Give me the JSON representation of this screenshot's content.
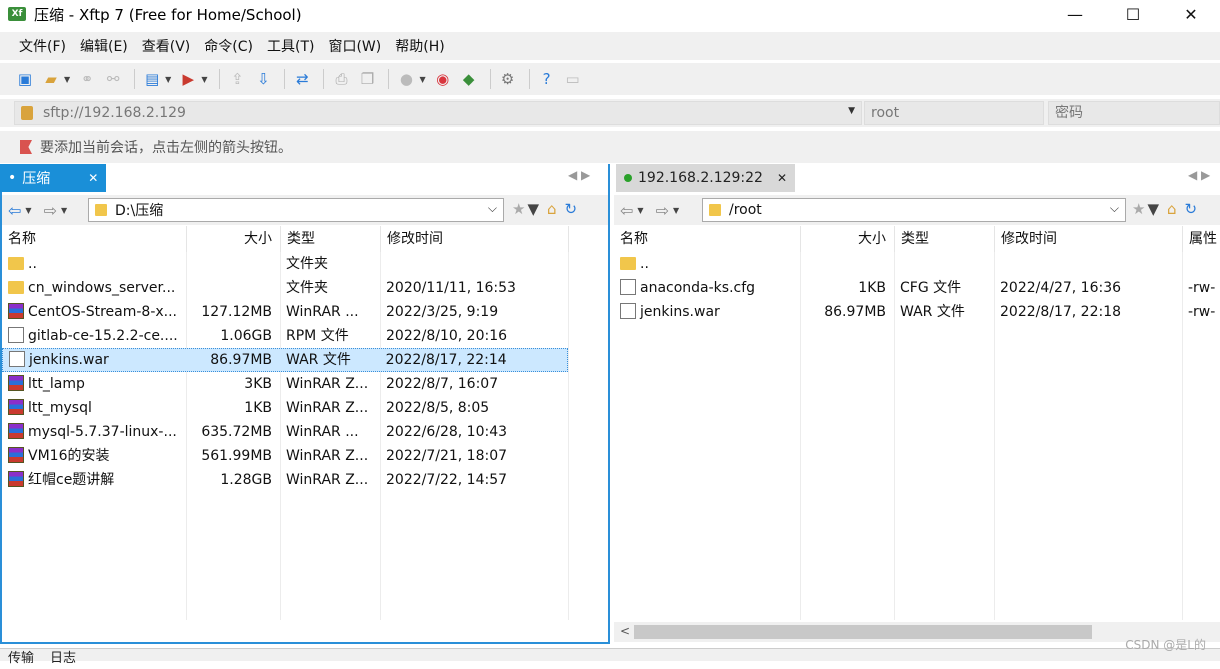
{
  "window": {
    "title": "压缩 - Xftp 7 (Free for Home/School)",
    "app_icon_text": "Xf"
  },
  "window_controls": {
    "minimize": "—",
    "maximize": "☐",
    "close": "✕"
  },
  "menu": [
    "文件(F)",
    "编辑(E)",
    "查看(V)",
    "命令(C)",
    "工具(T)",
    "窗口(W)",
    "帮助(H)"
  ],
  "address": {
    "url": "sftp://192.168.2.129",
    "user_placeholder": "root",
    "password_placeholder": "密码"
  },
  "hint": "要添加当前会话，点击左侧的箭头按钮。",
  "left": {
    "tab_label": "压缩",
    "path": "D:\\压缩",
    "columns": [
      "名称",
      "大小",
      "类型",
      "修改时间"
    ],
    "rows": [
      {
        "name": "..",
        "size": "",
        "type": "文件夹",
        "mtime": "",
        "icon": "folder"
      },
      {
        "name": "cn_windows_server...",
        "size": "",
        "type": "文件夹",
        "mtime": "2020/11/11, 16:53",
        "icon": "folder"
      },
      {
        "name": "CentOS-Stream-8-x...",
        "size": "127.12MB",
        "type": "WinRAR ...",
        "mtime": "2022/3/25, 9:19",
        "icon": "rar"
      },
      {
        "name": "gitlab-ce-15.2.2-ce....",
        "size": "1.06GB",
        "type": "RPM 文件",
        "mtime": "2022/8/10, 20:16",
        "icon": "doc"
      },
      {
        "name": "jenkins.war",
        "size": "86.97MB",
        "type": "WAR 文件",
        "mtime": "2022/8/17, 22:14",
        "icon": "doc",
        "selected": true
      },
      {
        "name": "ltt_lamp",
        "size": "3KB",
        "type": "WinRAR Z...",
        "mtime": "2022/8/7, 16:07",
        "icon": "rar"
      },
      {
        "name": "ltt_mysql",
        "size": "1KB",
        "type": "WinRAR Z...",
        "mtime": "2022/8/5, 8:05",
        "icon": "rar"
      },
      {
        "name": "mysql-5.7.37-linux-...",
        "size": "635.72MB",
        "type": "WinRAR ...",
        "mtime": "2022/6/28, 10:43",
        "icon": "rar"
      },
      {
        "name": "VM16的安装",
        "size": "561.99MB",
        "type": "WinRAR Z...",
        "mtime": "2022/7/21, 18:07",
        "icon": "rar"
      },
      {
        "name": "红帽ce题讲解",
        "size": "1.28GB",
        "type": "WinRAR Z...",
        "mtime": "2022/7/22, 14:57",
        "icon": "rar"
      }
    ]
  },
  "right": {
    "tab_label": "192.168.2.129:22",
    "path": "/root",
    "columns": [
      "名称",
      "大小",
      "类型",
      "修改时间",
      "属性"
    ],
    "rows": [
      {
        "name": "..",
        "size": "",
        "type": "",
        "mtime": "",
        "attr": "",
        "icon": "folder"
      },
      {
        "name": "anaconda-ks.cfg",
        "size": "1KB",
        "type": "CFG 文件",
        "mtime": "2022/4/27, 16:36",
        "attr": "-rw-",
        "icon": "doc"
      },
      {
        "name": "jenkins.war",
        "size": "86.97MB",
        "type": "WAR 文件",
        "mtime": "2022/8/17, 22:18",
        "attr": "-rw-",
        "icon": "doc"
      }
    ]
  },
  "bottom_tabs": [
    "传输",
    "日志"
  ],
  "watermark": "CSDN @是L的"
}
